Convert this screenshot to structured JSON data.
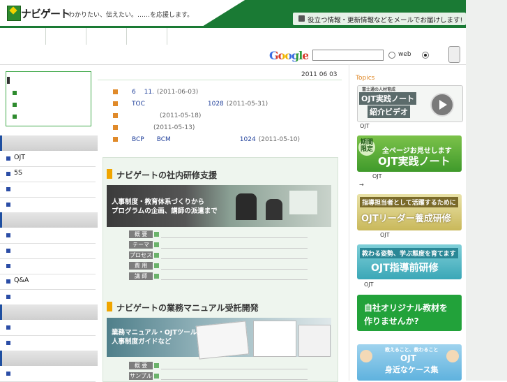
{
  "header": {
    "logo": "ナビゲート",
    "tagline": "わかりたい、伝えたい。……を応援します。",
    "banner_text": "役立つ情報・更新情報などをメールでお届けします!"
  },
  "search": {
    "logo": "Google",
    "value": "",
    "option_web": "web"
  },
  "main": {
    "date": "2011 06 03",
    "news": [
      {
        "title": "6　 11.",
        "date": "(2011-06-03)"
      },
      {
        "title": "TOC　　　　　　　　　　1028",
        "date": "(2011-05-31)"
      },
      {
        "title": "　　　　",
        "date": "(2011-05-18)"
      },
      {
        "title": "　　　",
        "date": "(2011-05-13)"
      },
      {
        "title": "BCP　　BCM　　　　　　　　　　　1024",
        "date": "(2011-05-10)"
      }
    ],
    "section1": {
      "title": "ナビゲートの社内研修支援",
      "image_text_1": "人事制度・教育体系づくりから",
      "image_text_2": "プログラムの企画、講師の派遣まで",
      "specs": [
        "概 要",
        "テーマ",
        "プロセス",
        "費 用",
        "講 師"
      ]
    },
    "section2": {
      "title": "ナビゲートの業務マニュアル受託開発",
      "image_text_1": "業務マニュアル・OJTツール、",
      "image_text_2": "人事制度ガイドなど",
      "specs": [
        "概 要",
        "サンプル"
      ]
    }
  },
  "left_menu": {
    "items": [
      {
        "type": "head",
        "label": ""
      },
      {
        "type": "item",
        "label": "OJT"
      },
      {
        "type": "item",
        "label": "5S"
      },
      {
        "type": "item",
        "label": ""
      },
      {
        "type": "item",
        "label": ""
      },
      {
        "type": "head",
        "label": ""
      },
      {
        "type": "item",
        "label": ""
      },
      {
        "type": "item",
        "label": ""
      },
      {
        "type": "item",
        "label": ""
      },
      {
        "type": "item",
        "label": "Q&A"
      },
      {
        "type": "item",
        "label": ""
      },
      {
        "type": "head",
        "label": ""
      },
      {
        "type": "item",
        "label": ""
      },
      {
        "type": "item",
        "label": ""
      },
      {
        "type": "head",
        "label": ""
      },
      {
        "type": "item",
        "label": ""
      }
    ]
  },
  "right": {
    "topics_label": "Topics",
    "banners": [
      {
        "line1": "OJT実践ノート",
        "line2": "紹介ビデオ",
        "small": "富士通の人材育成",
        "caption": "OJT"
      },
      {
        "line1": "全ページお見せします",
        "line2": "OJT実践ノート",
        "tag": "期間限定",
        "caption": "OJT",
        "caption2": "→"
      },
      {
        "line1": "指導担当者として活躍するために",
        "line2": "OJTリーダー養成研修",
        "caption": "OJT"
      },
      {
        "line1": "教わる姿勢、学ぶ態度を育てます",
        "line2": "OJT指導前研修",
        "caption": "OJT"
      },
      {
        "line1": "自社オリジナル教材を",
        "line2": "作りませんか?"
      },
      {
        "line1": "教えること、教わること",
        "line2": "OJT",
        "line3": "身近なケース集"
      }
    ]
  },
  "colors": {
    "brand_green": "#1a7a34",
    "link_blue": "#1f3f9a",
    "accent_orange": "#e08a2a"
  }
}
